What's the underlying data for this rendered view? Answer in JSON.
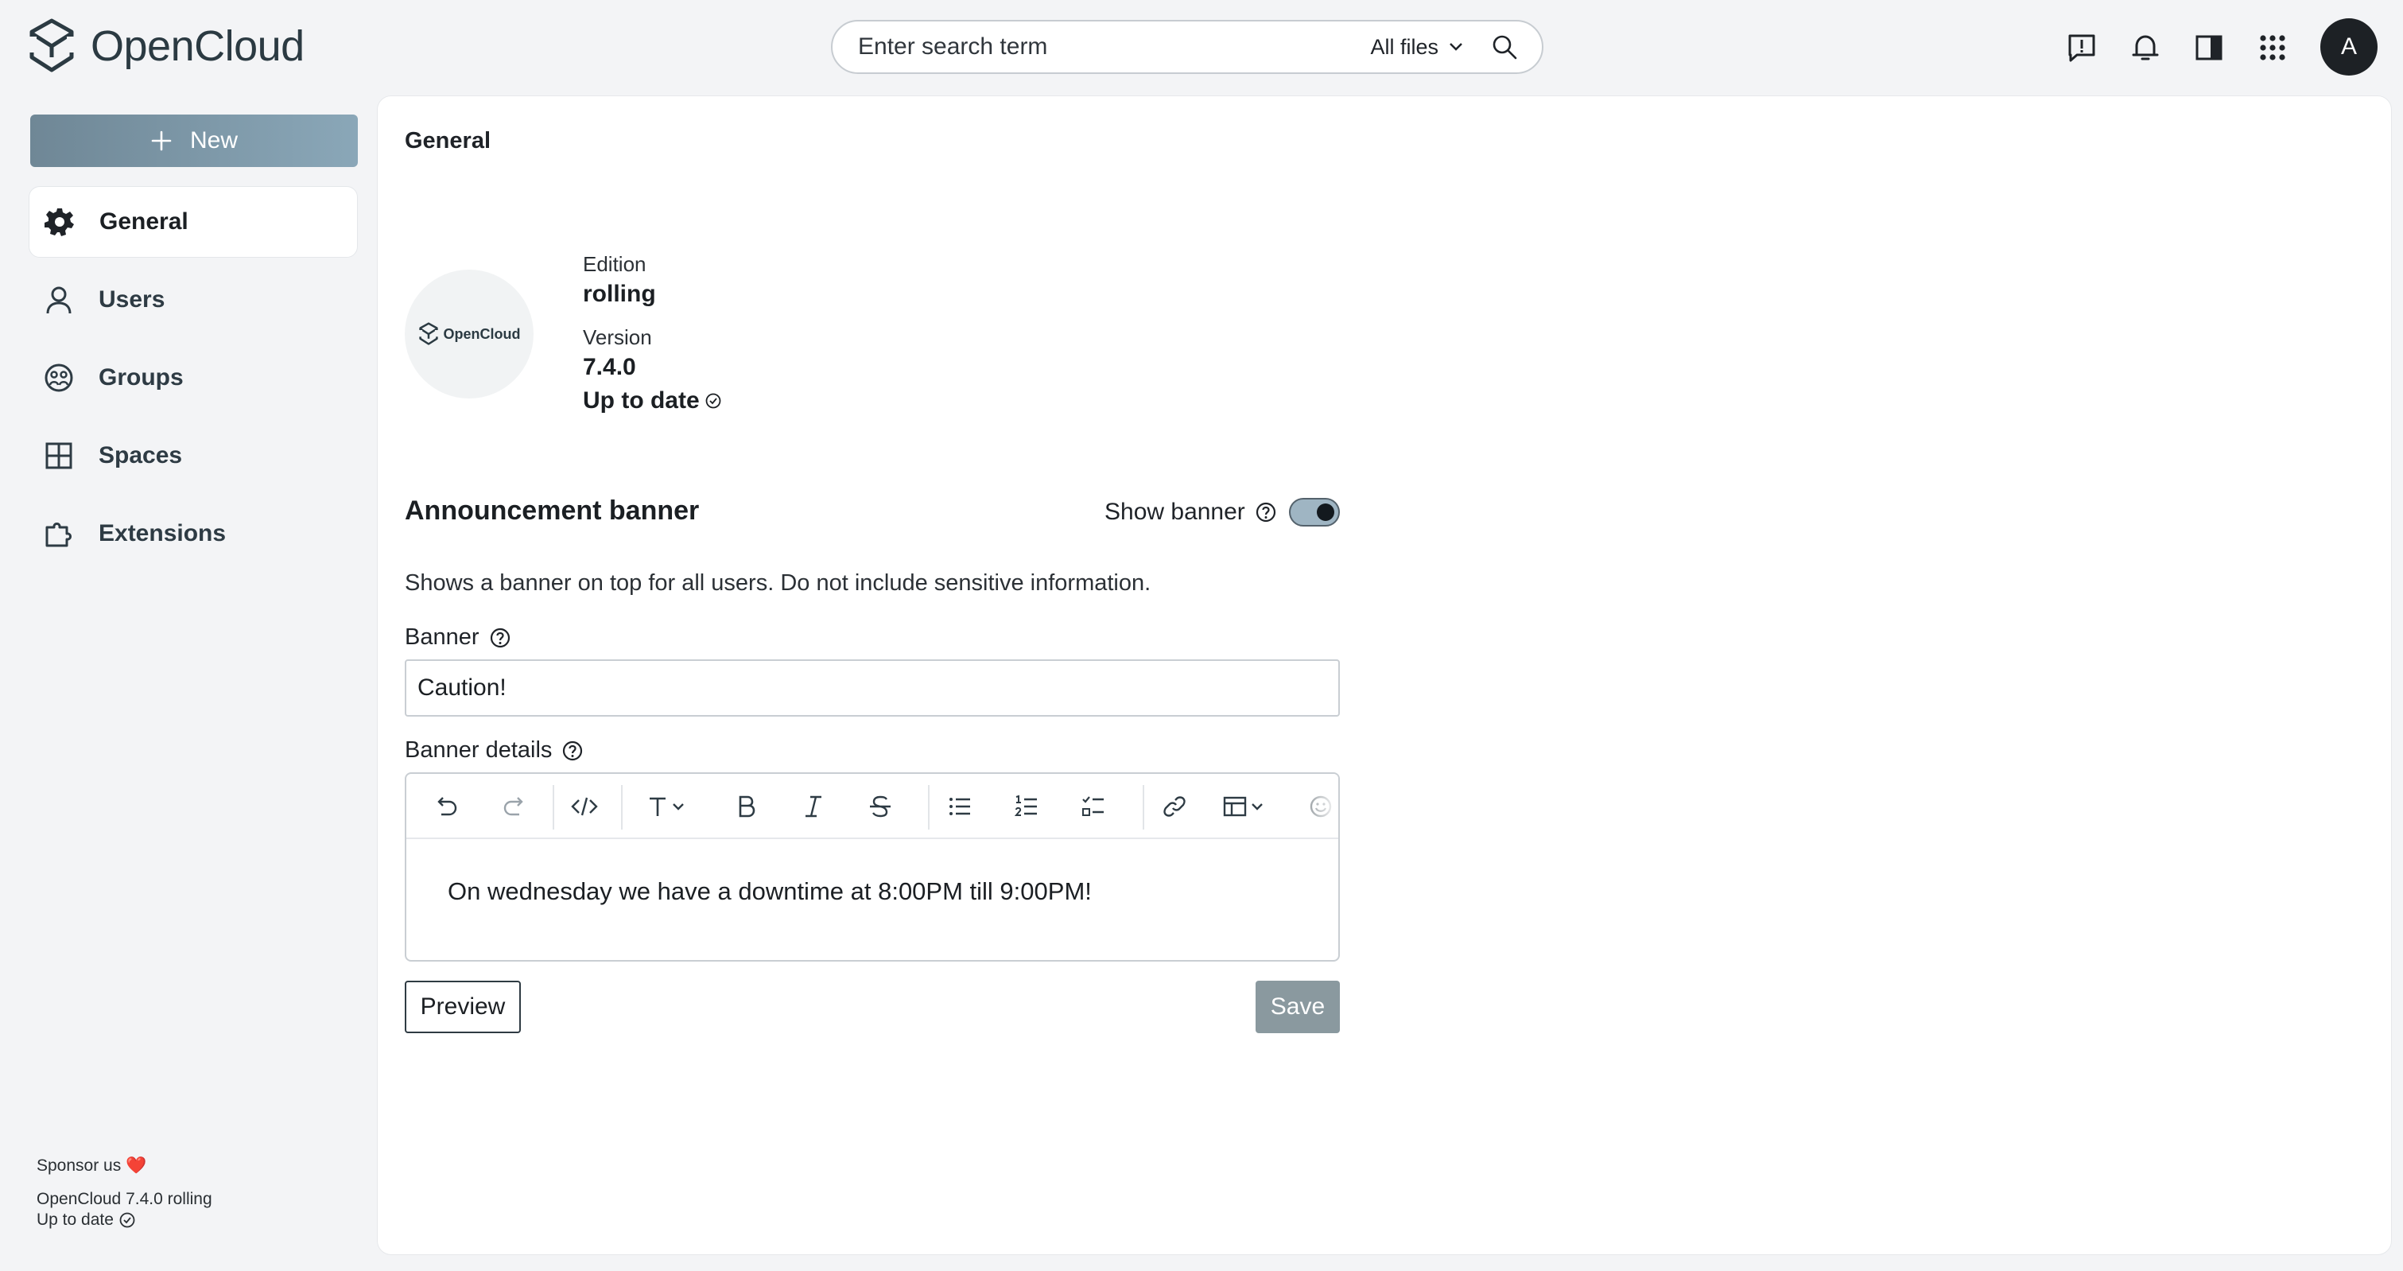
{
  "app": {
    "name": "OpenCloud"
  },
  "search": {
    "placeholder": "Enter search term",
    "scope": "All files"
  },
  "header": {
    "avatar_initial": "A"
  },
  "sidebar": {
    "new_label": "New",
    "items": [
      {
        "label": "General",
        "icon": "gear-icon",
        "active": true
      },
      {
        "label": "Users",
        "icon": "user-icon",
        "active": false
      },
      {
        "label": "Groups",
        "icon": "groups-icon",
        "active": false
      },
      {
        "label": "Spaces",
        "icon": "spaces-icon",
        "active": false
      },
      {
        "label": "Extensions",
        "icon": "puzzle-icon",
        "active": false
      }
    ],
    "sponsor": "Sponsor us ❤️",
    "version_line": "OpenCloud 7.4.0 rolling",
    "status_line": "Up to date"
  },
  "main": {
    "title": "General",
    "logo_text": "OpenCloud",
    "edition_label": "Edition",
    "edition_value": "rolling",
    "version_label": "Version",
    "version_value": "7.4.0",
    "update_status": "Up to date"
  },
  "banner": {
    "section_title": "Announcement banner",
    "show_banner_label": "Show banner",
    "show_banner_on": true,
    "description": "Shows a banner on top for all users. Do not include sensitive information.",
    "banner_label": "Banner",
    "banner_value": "Caution!",
    "details_label": "Banner details",
    "details_content": "On wednesday we have a downtime at 8:00PM till 9:00PM!",
    "preview_label": "Preview",
    "save_label": "Save"
  },
  "colors": {
    "accent": "#8aa7b8",
    "save_disabled": "#8a999f",
    "avatar_bg": "#1d2125"
  }
}
